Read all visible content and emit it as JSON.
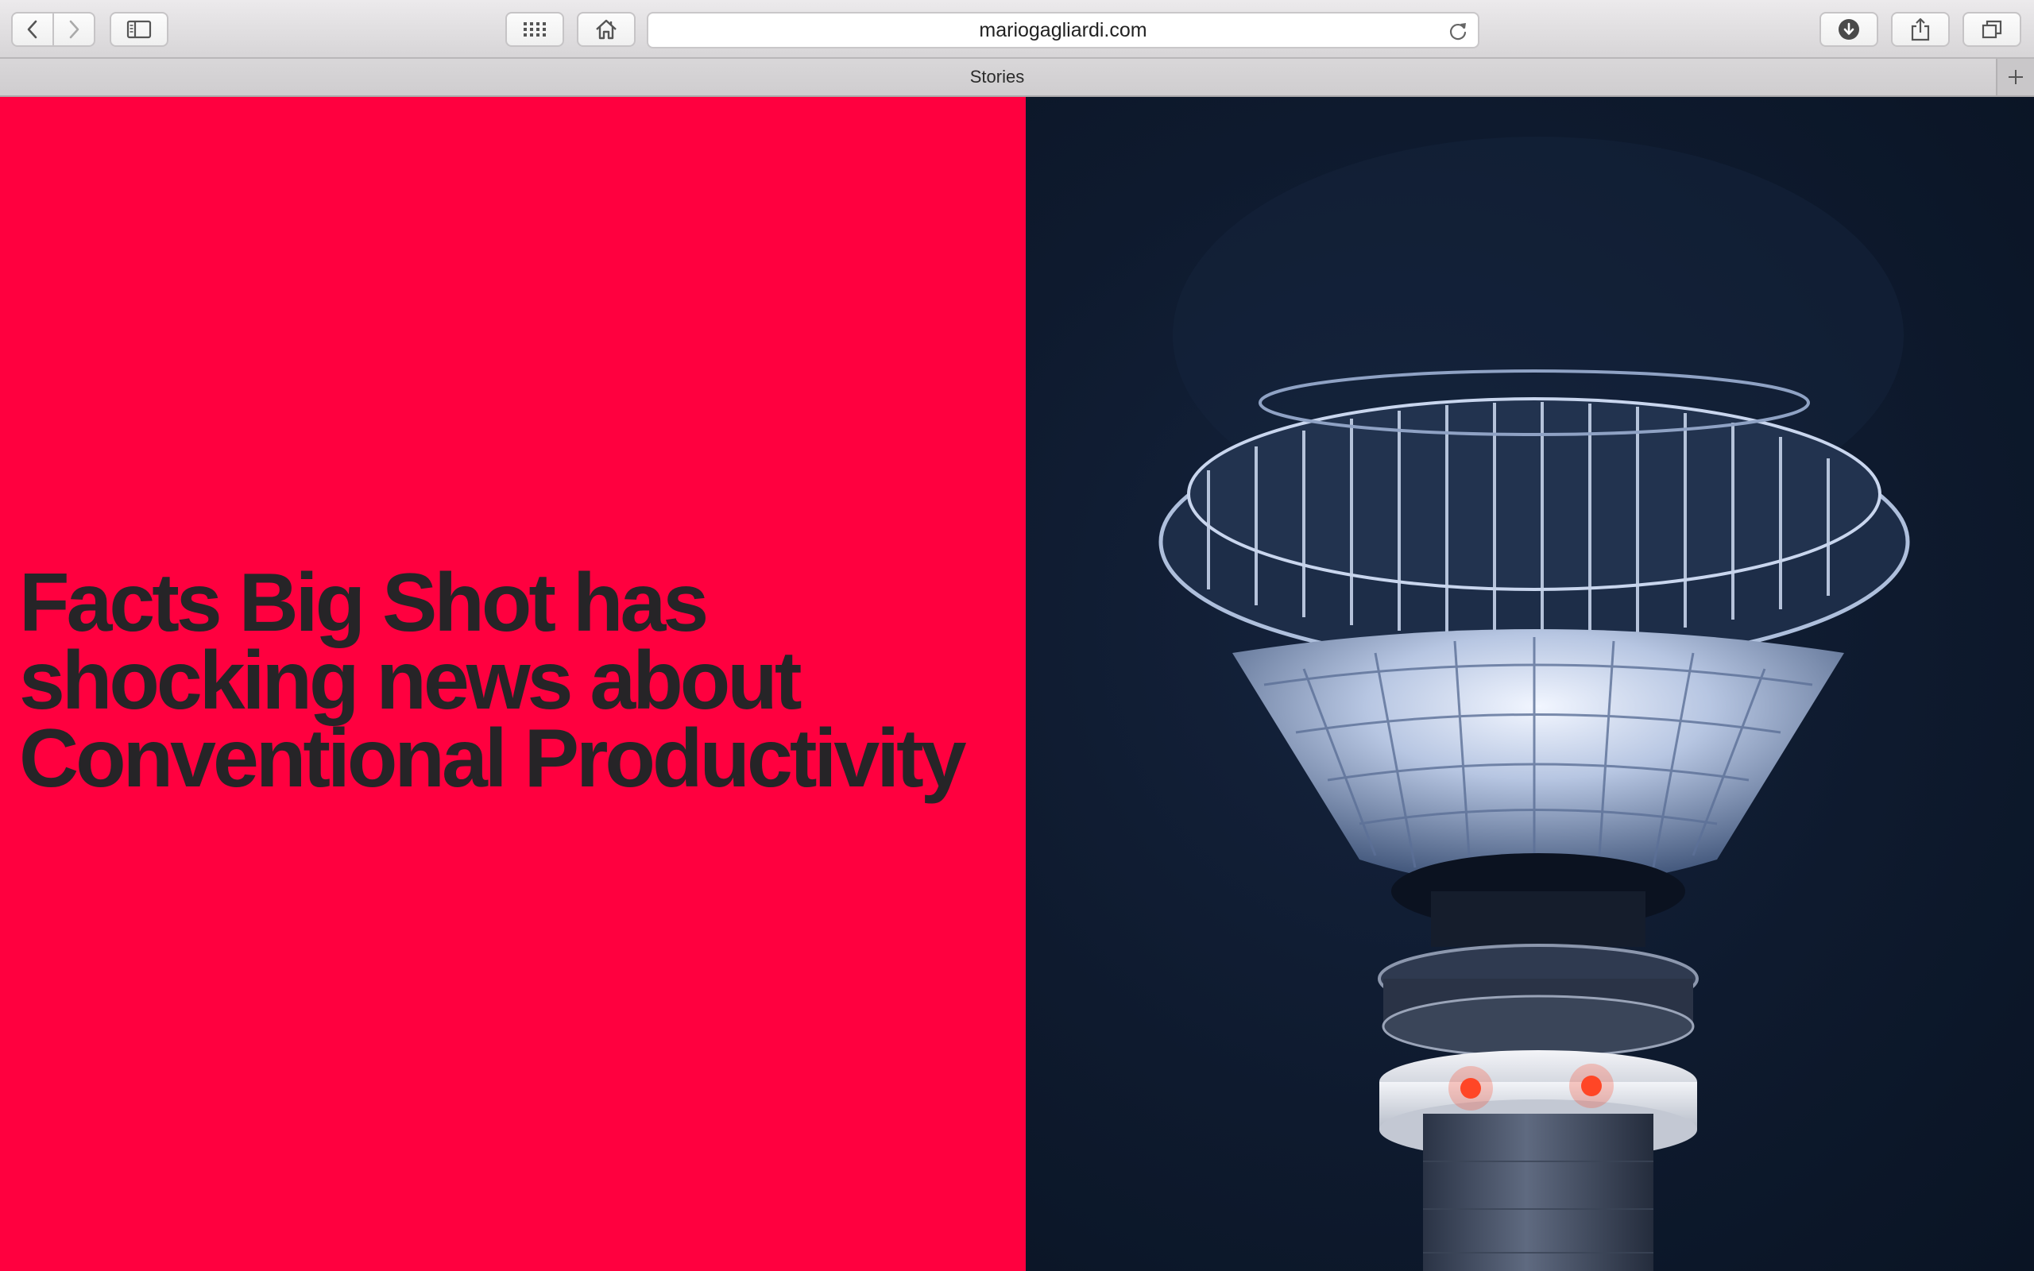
{
  "browser": {
    "url": "mariogagliardi.com",
    "tab_title": "Stories"
  },
  "toolbar_icons": [
    "back-icon",
    "forward-icon",
    "sidebar-icon",
    "top-sites-icon",
    "home-icon",
    "reload-icon",
    "download-icon",
    "share-icon",
    "tabs-icon",
    "plus-icon"
  ],
  "page": {
    "headline": "Facts Big Shot has shocking news about Conventional Productivity"
  },
  "colors": {
    "accent": "#ff003f",
    "headline_text": "#262427",
    "photo_background": "#0f1a2c"
  }
}
